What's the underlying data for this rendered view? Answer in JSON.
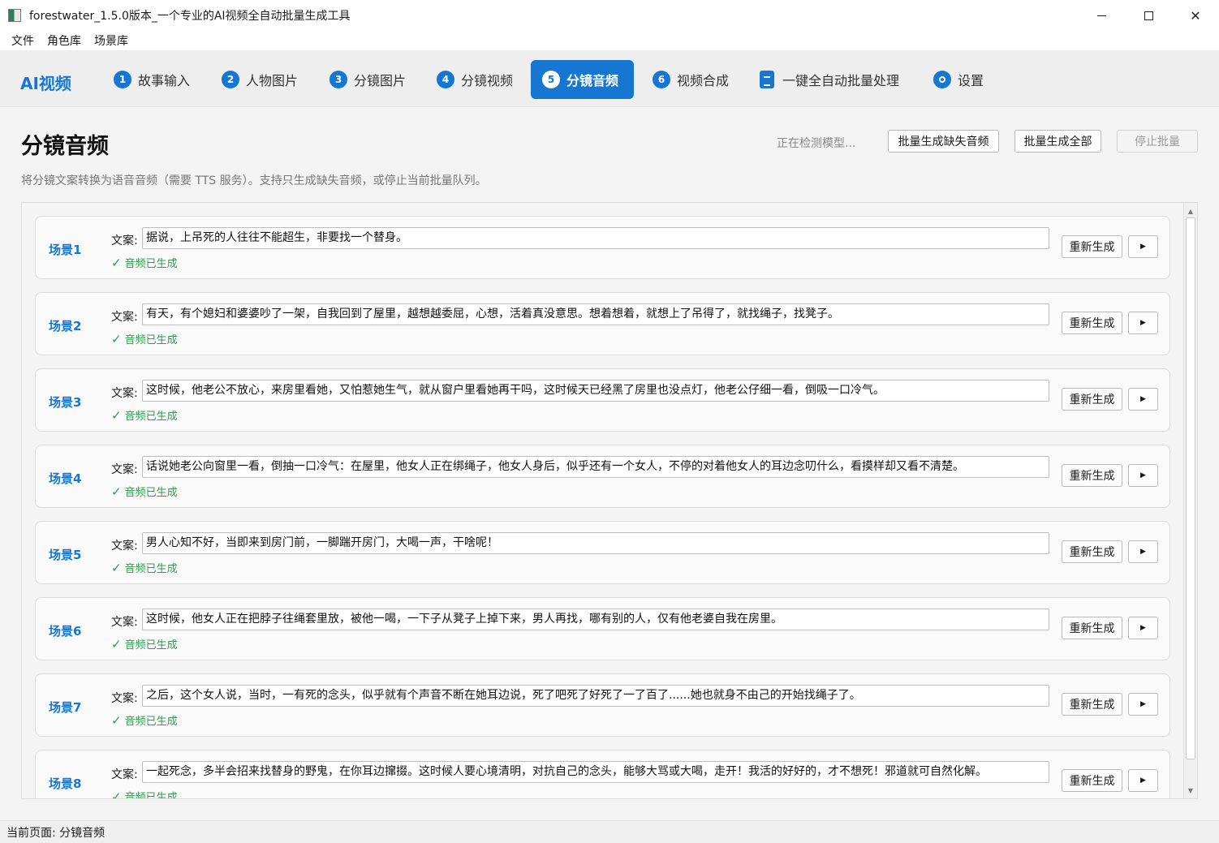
{
  "window": {
    "title": "forestwater_1.5.0版本_一个专业的AI视频全自动批量生成工具",
    "minimize_label": "—",
    "maximize_label": "□",
    "close_label": "✕"
  },
  "menubar": {
    "items": [
      "文件",
      "角色库",
      "场景库"
    ]
  },
  "nav": {
    "brand": "AI视频",
    "tabs": [
      {
        "num": "1",
        "label": "故事输入"
      },
      {
        "num": "2",
        "label": "人物图片"
      },
      {
        "num": "3",
        "label": "分镜图片"
      },
      {
        "num": "4",
        "label": "分镜视频"
      },
      {
        "num": "5",
        "label": "分镜音频"
      },
      {
        "num": "6",
        "label": "视频合成"
      },
      {
        "num": "",
        "label": "一键全自动批量处理"
      },
      {
        "num": "",
        "label": "设置"
      }
    ],
    "active_index": 4
  },
  "page": {
    "title": "分镜音频",
    "description": "将分镜文案转换为语音音频（需要 TTS 服务）。支持只生成缺失音频，或停止当前批量队列。",
    "model_status": "正在检测模型...",
    "buttons": {
      "generate_missing": "批量生成缺失音频",
      "generate_all": "批量生成全部",
      "stop_batch": "停止批量"
    }
  },
  "scene_list": {
    "text_label": "文案:",
    "regen_label": "重新生成",
    "play_label": "▶",
    "status_check": "✓",
    "scenes": [
      {
        "name": "场景1",
        "text": "据说，上吊死的人往往不能超生，非要找一个替身。",
        "status": "音频已生成"
      },
      {
        "name": "场景2",
        "text": "有天，有个媳妇和婆婆吵了一架，自我回到了屋里，越想越委屈，心想，活着真没意思。想着想着，就想上了吊得了，就找绳子，找凳子。",
        "status": "音频已生成"
      },
      {
        "name": "场景3",
        "text": "这时候，他老公不放心，来房里看她，又怕惹她生气，就从窗户里看她再干吗，这时候天已经黑了房里也没点灯，他老公仔细一看，倒吸一口冷气。",
        "status": "音频已生成"
      },
      {
        "name": "场景4",
        "text": "话说她老公向窗里一看，倒抽一口冷气：在屋里，他女人正在绑绳子，他女人身后，似乎还有一个女人，不停的对着他女人的耳边念叨什么，看摸样却又看不清楚。",
        "status": "音频已生成"
      },
      {
        "name": "场景5",
        "text": "男人心知不好，当即来到房门前，一脚踹开房门，大喝一声，干啥呢！",
        "status": "音频已生成"
      },
      {
        "name": "场景6",
        "text": "这时候，他女人正在把脖子往绳套里放，被他一喝，一下子从凳子上掉下来，男人再找，哪有别的人，仅有他老婆自我在房里。",
        "status": "音频已生成"
      },
      {
        "name": "场景7",
        "text": "之后，这个女人说，当时，一有死的念头，似乎就有个声音不断在她耳边说，死了吧死了好死了一了百了......她也就身不由己的开始找绳子了。",
        "status": "音频已生成"
      },
      {
        "name": "场景8",
        "text": "一起死念，多半会招来找替身的野鬼，在你耳边撺掇。这时候人要心境清明，对抗自己的念头，能够大骂或大喝，走开！我活的好好的，才不想死！邪道就可自然化解。",
        "status": "音频已生成"
      }
    ]
  },
  "statusbar": {
    "text": "当前页面: 分镜音频"
  },
  "colors": {
    "accent": "#1677d2",
    "success": "#2e9e4d",
    "background": "#f3f3f3"
  }
}
